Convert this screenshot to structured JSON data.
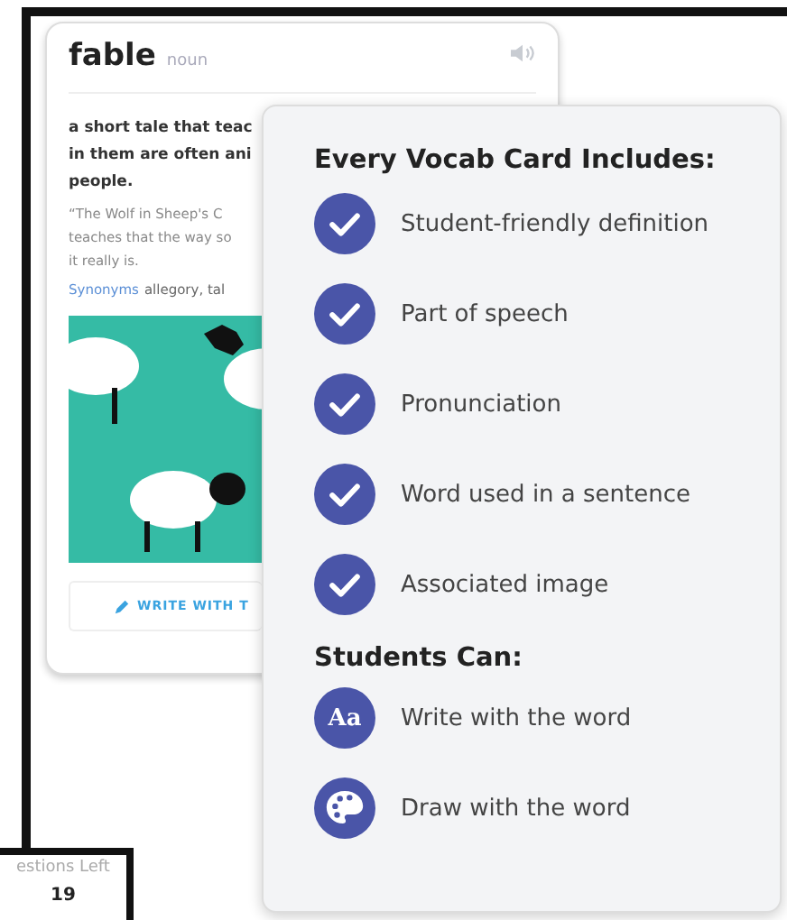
{
  "word_card": {
    "word": "fable",
    "part_of_speech": "noun",
    "definition_lines": [
      "a short tale that teac",
      "in them are often ani",
      "people."
    ],
    "example_lines": [
      "“The Wolf in Sheep's C",
      "teaches that the way so",
      "it really is."
    ],
    "synonyms_label": "Synonyms",
    "synonyms": "allegory, tal",
    "button_label": "WRITE WITH T"
  },
  "counter": {
    "label": "estions Left",
    "value": "19"
  },
  "features_panel": {
    "title": "Every Vocab Card Includes:",
    "includes": [
      {
        "text": "Student-friendly definition"
      },
      {
        "text": "Part of speech"
      },
      {
        "text": "Pronunciation"
      },
      {
        "text": "Word used in a sentence"
      },
      {
        "text": "Associated image"
      }
    ],
    "students_title": "Students Can:",
    "student_actions": [
      {
        "kind": "letters",
        "icon_label": "Aa",
        "text": "Write with the word"
      },
      {
        "kind": "palette",
        "text": "Draw with the word"
      }
    ]
  }
}
